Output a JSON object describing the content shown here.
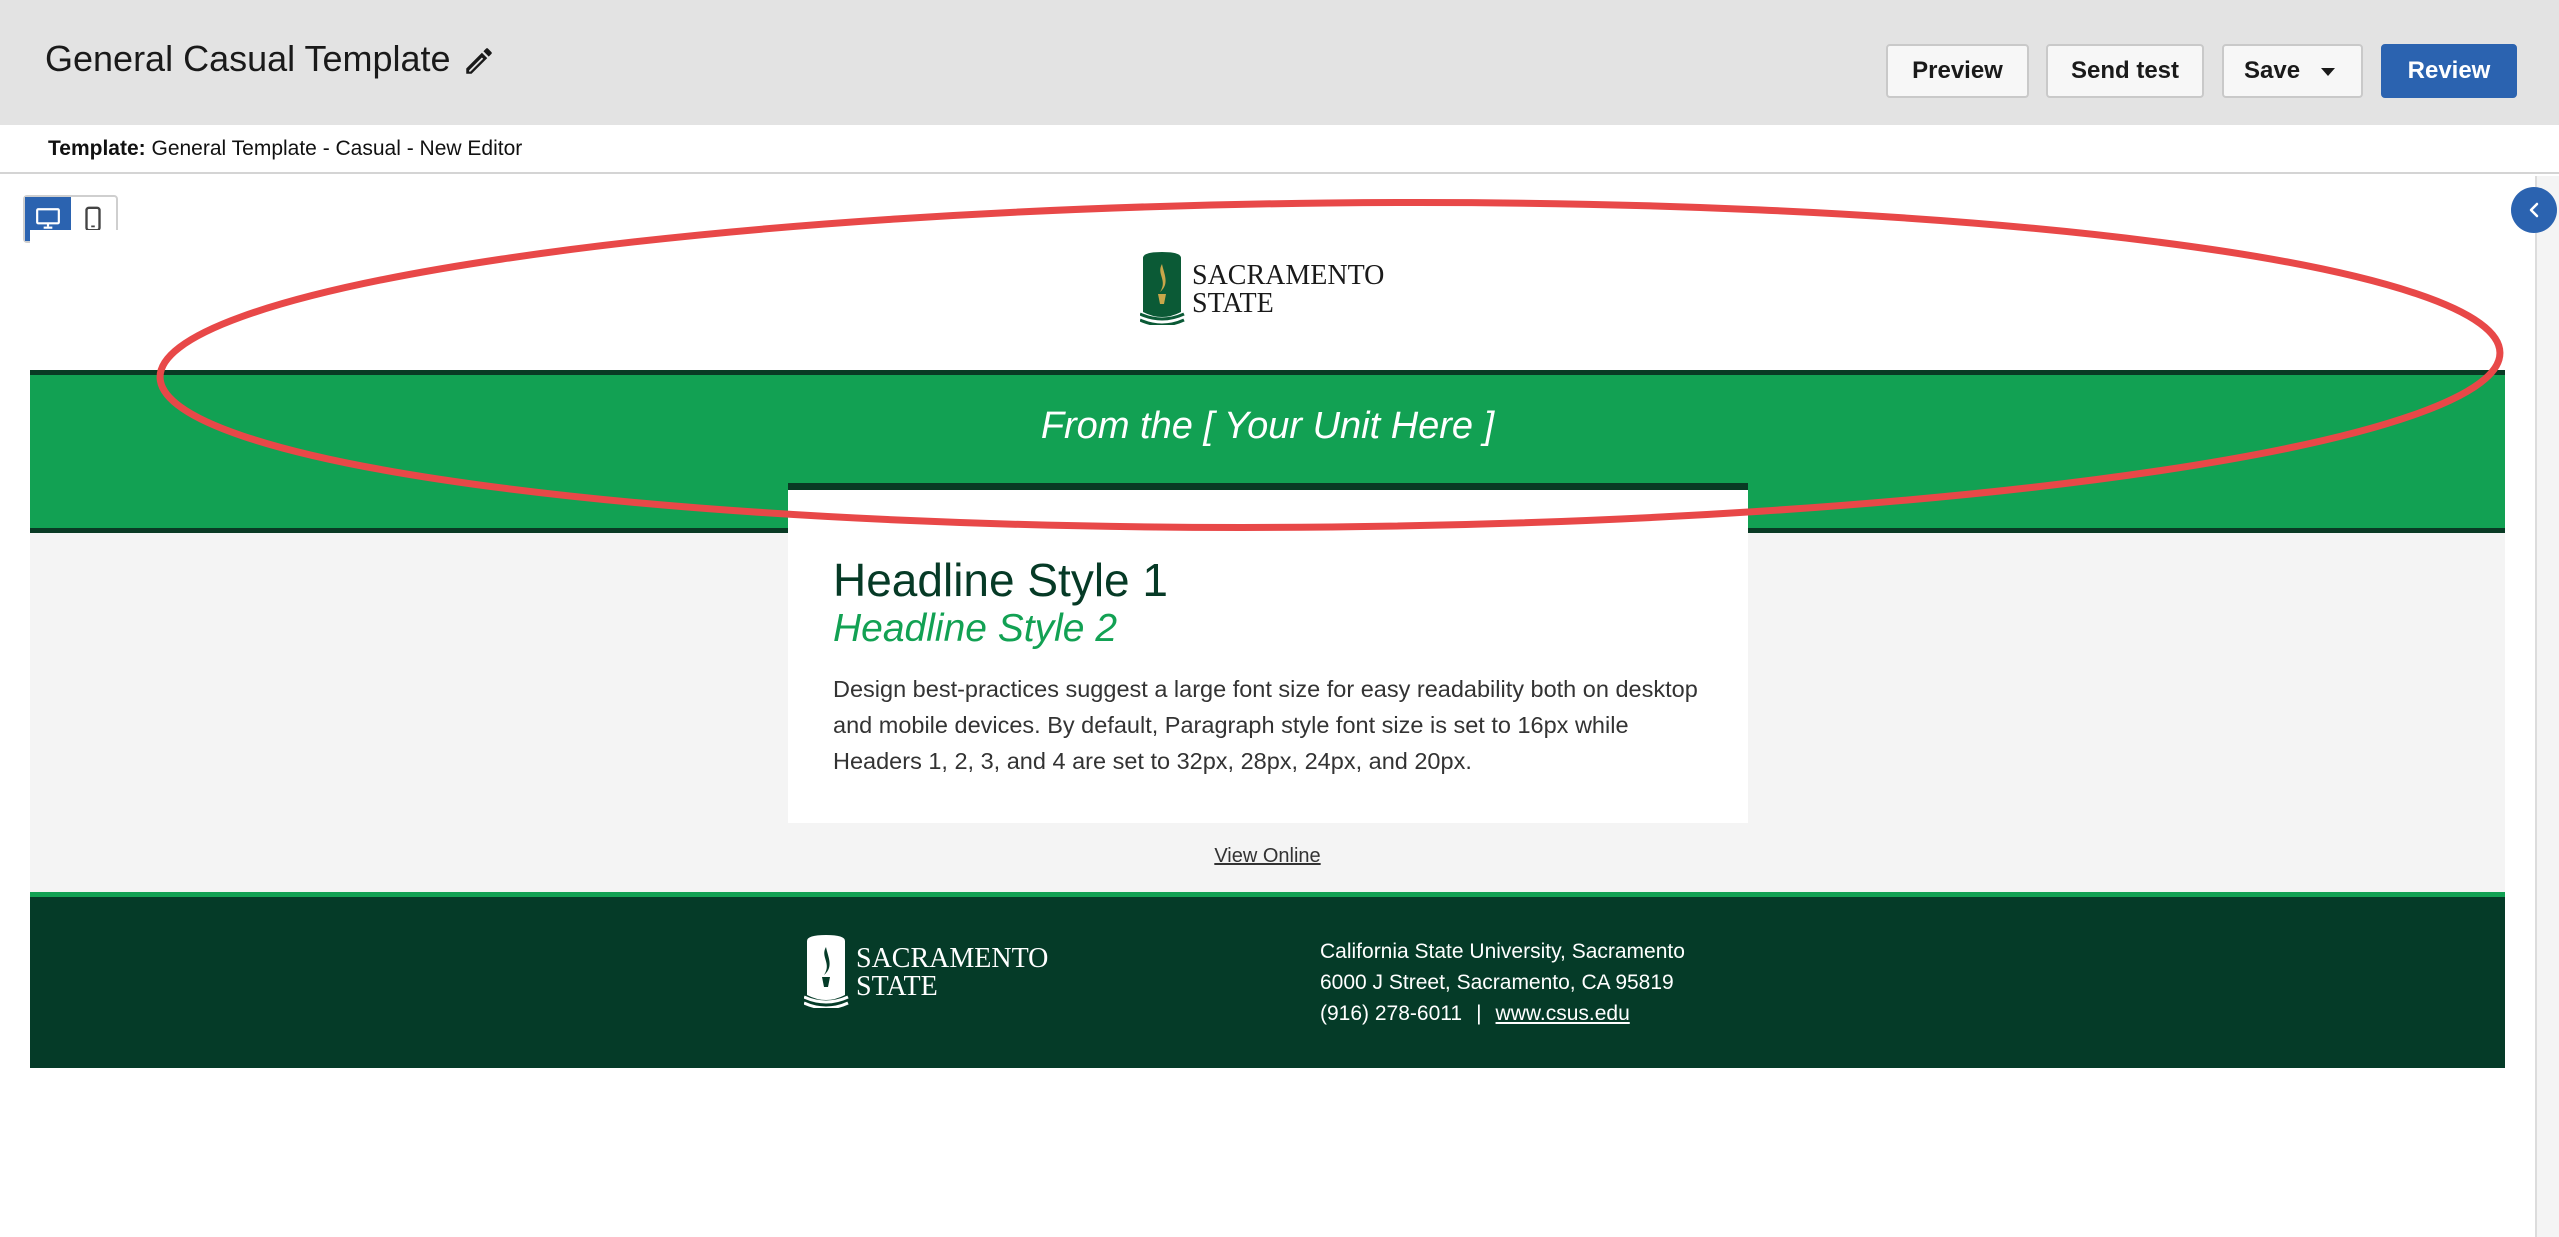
{
  "header": {
    "title": "General Casual Template",
    "buttons": {
      "preview": "Preview",
      "send_test": "Send test",
      "save": "Save",
      "review": "Review"
    }
  },
  "template_info": {
    "label": "Template:",
    "value": "General Template - Casual - New Editor"
  },
  "email": {
    "logo_top_line1": "SACRAMENTO",
    "logo_top_line2": "STATE",
    "band_text": "From the [ Your Unit Here ]",
    "headline1": "Headline Style 1",
    "headline2": "Headline Style 2",
    "paragraph": "Design best-practices suggest a large font size for easy readability both on desktop and mobile devices. By default, Paragraph style font size is set to 16px while Headers 1, 2, 3, and 4 are set to 32px, 28px, 24px, and 20px.",
    "view_online": "View Online",
    "footer": {
      "logo_line1": "SACRAMENTO",
      "logo_line2": "STATE",
      "address_line1": "California State University, Sacramento",
      "address_line2": "6000 J Street, Sacramento, CA 95819",
      "phone": "(916) 278-6011",
      "separator": "|",
      "website": "www.csus.edu"
    }
  },
  "colors": {
    "brand_green": "#12a153",
    "dark_green": "#053b28",
    "accent_blue": "#2b63b0",
    "annotation_red": "#e84848"
  },
  "icons": [
    "pencil-icon",
    "desktop-icon",
    "mobile-icon",
    "chevron-left-icon",
    "sac-state-torch-icon"
  ]
}
